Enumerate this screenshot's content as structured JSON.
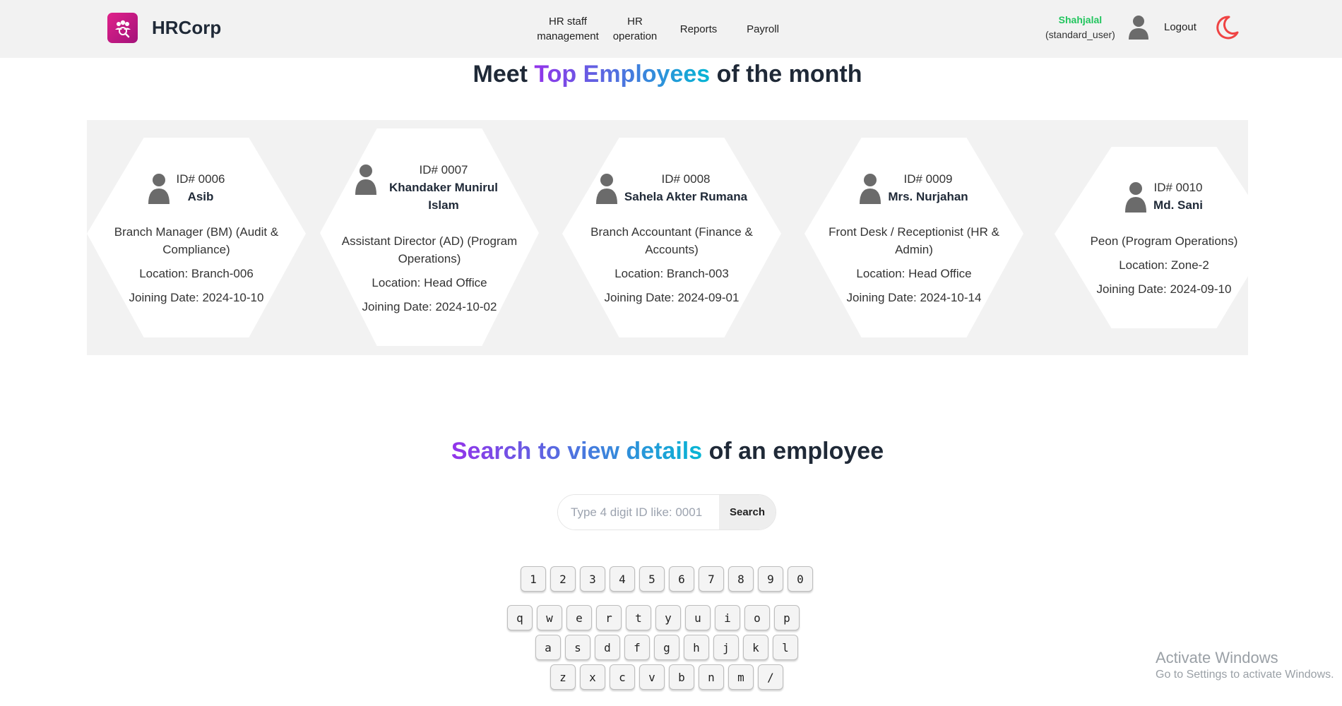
{
  "app": {
    "name": "HRCorp"
  },
  "nav": {
    "links": [
      {
        "line1": "HR staff",
        "line2": "management"
      },
      {
        "line1": "HR",
        "line2": "operation"
      },
      {
        "line1": "Reports",
        "line2": ""
      },
      {
        "line1": "Payroll",
        "line2": ""
      }
    ],
    "user_name": "Shahjalal",
    "user_role": "(standard_user)",
    "logout_label": "Logout"
  },
  "top_section": {
    "title_before": "Meet ",
    "title_highlight": "Top Employees",
    "title_after": " of the month"
  },
  "employees": [
    {
      "id": "ID# 0006",
      "name": "Asib",
      "role": "Branch Manager (BM) (Audit & Compliance)",
      "location": "Location: Branch-006",
      "joining": "Joining Date: 2024-10-10"
    },
    {
      "id": "ID# 0007",
      "name": "Khandaker Munirul Islam",
      "role": "Assistant Director (AD) (Program Operations)",
      "location": "Location: Head Office",
      "joining": "Joining Date: 2024-10-02"
    },
    {
      "id": "ID# 0008",
      "name": "Sahela Akter Rumana",
      "role": "Branch Accountant (Finance & Accounts)",
      "location": "Location: Branch-003",
      "joining": "Joining Date: 2024-09-01"
    },
    {
      "id": "ID# 0009",
      "name": "Mrs. Nurjahan",
      "role": "Front Desk / Receptionist (HR & Admin)",
      "location": "Location: Head Office",
      "joining": "Joining Date: 2024-10-14"
    },
    {
      "id": "ID# 0010",
      "name": "Md. Sani",
      "role": "Peon (Program Operations)",
      "location": "Location: Zone-2",
      "joining": "Joining Date: 2024-09-10"
    }
  ],
  "search_section": {
    "title_highlight": "Search to view details",
    "title_after": " of an employee",
    "placeholder": "Type 4 digit ID like: 0001",
    "value": "",
    "button_label": "Search"
  },
  "keyboard": {
    "row1": [
      "1",
      "2",
      "3",
      "4",
      "5",
      "6",
      "7",
      "8",
      "9",
      "0"
    ],
    "row2": [
      "q",
      "w",
      "e",
      "r",
      "t",
      "y",
      "u",
      "i",
      "o",
      "p"
    ],
    "row3": [
      "a",
      "s",
      "d",
      "f",
      "g",
      "h",
      "j",
      "k",
      "l"
    ],
    "row4": [
      "z",
      "x",
      "c",
      "v",
      "b",
      "n",
      "m",
      "/"
    ]
  },
  "watermark": {
    "title": "Activate Windows",
    "subtitle": "Go to Settings to activate Windows."
  },
  "colors": {
    "brand": "#d81b84",
    "user_name": "#22c55e",
    "moon": "#ef4444",
    "gradient_start": "#9333ea",
    "gradient_end": "#06b6d4"
  }
}
